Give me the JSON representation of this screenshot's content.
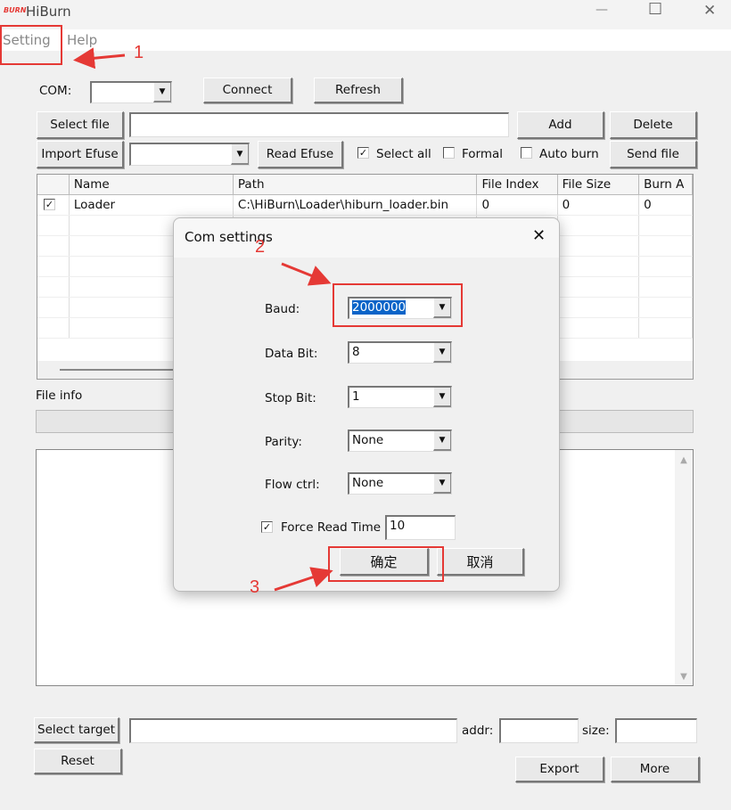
{
  "window": {
    "title": "HiBurn",
    "logo_text": "BURN",
    "minimize": "—",
    "maximize": "☐",
    "close": "✕"
  },
  "menu": [
    {
      "label": "Setting"
    },
    {
      "label": "Help"
    }
  ],
  "toolbar": {
    "com_label": "COM:",
    "com_value": "",
    "connect": "Connect",
    "refresh": "Refresh",
    "select_file": "Select file",
    "file_path": "",
    "add": "Add",
    "delete": "Delete",
    "import_efuse": "Import Efuse",
    "efuse_value": "",
    "read_efuse": "Read Efuse",
    "select_all": "Select all",
    "select_all_checked": true,
    "formal": "Formal",
    "formal_checked": false,
    "auto_burn": "Auto burn",
    "auto_burn_checked": false,
    "send_file": "Send file"
  },
  "table": {
    "columns": [
      "",
      "Name",
      "Path",
      "File Index",
      "File Size",
      "Burn A"
    ],
    "rows": [
      {
        "checked": true,
        "name": "Loader",
        "path": "C:\\HiBurn\\Loader\\hiburn_loader.bin",
        "file_index": "0",
        "file_size": "0",
        "burn_addr": "0"
      }
    ]
  },
  "file_info": {
    "label": "File info",
    "progress": 0
  },
  "bottom": {
    "select_target": "Select target",
    "target_value": "",
    "addr_label": "addr:",
    "addr_value": "",
    "size_label": "size:",
    "size_value": "",
    "reset": "Reset",
    "export": "Export",
    "more": "More"
  },
  "dialog": {
    "title": "Com settings",
    "close": "✕",
    "fields": [
      {
        "label": "Baud:",
        "value": "2000000"
      },
      {
        "label": "Data Bit:",
        "value": "8"
      },
      {
        "label": "Stop Bit:",
        "value": "1"
      },
      {
        "label": "Parity:",
        "value": "None"
      },
      {
        "label": "Flow ctrl:",
        "value": "None"
      }
    ],
    "force_read_label": "Force Read Time",
    "force_read_checked": true,
    "force_read_value": "10",
    "ok": "确定",
    "cancel": "取消"
  },
  "annotations": {
    "step1": "1",
    "step2": "2",
    "step3": "3",
    "color": "#e53935"
  }
}
